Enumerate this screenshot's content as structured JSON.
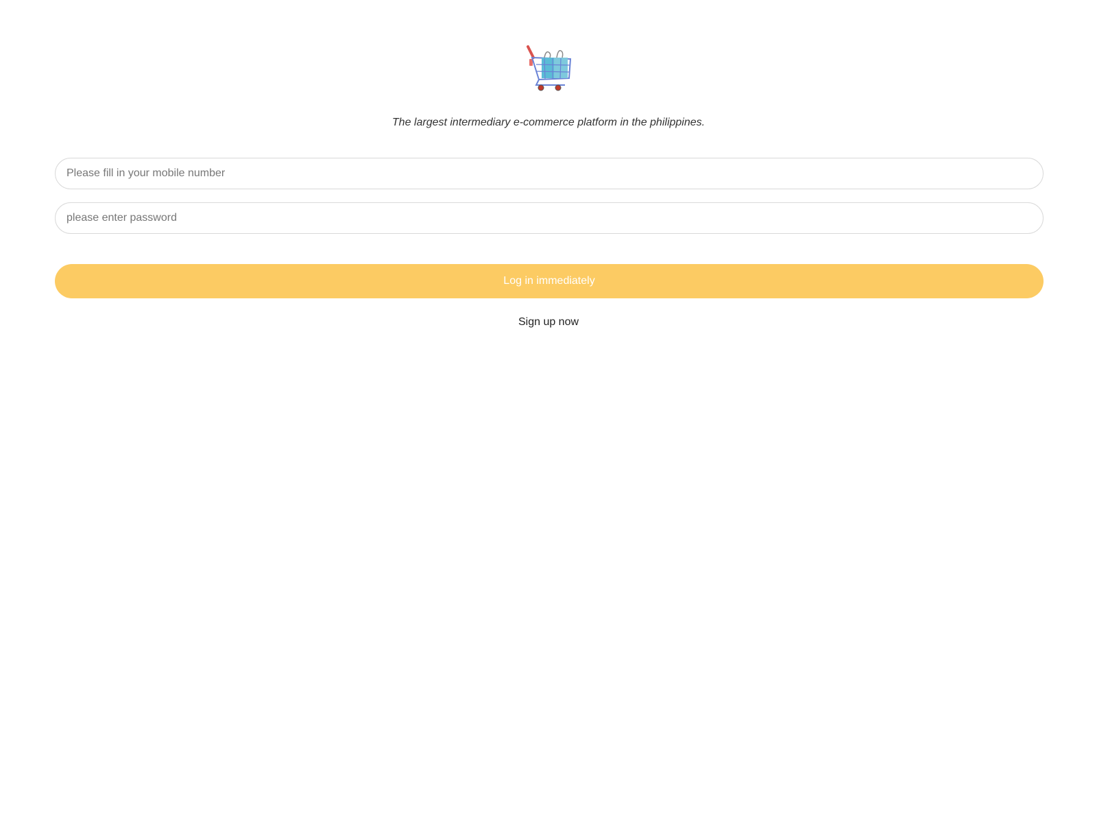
{
  "logo": {
    "icon": "shopping-cart-icon"
  },
  "tagline": "The largest intermediary e-commerce platform in the philippines.",
  "form": {
    "mobile": {
      "value": "",
      "placeholder": "Please fill in your mobile number"
    },
    "password": {
      "value": "",
      "placeholder": "please enter password"
    },
    "login_label": "Log in immediately",
    "signup_label": "Sign up now"
  },
  "colors": {
    "accent": "#fccb63",
    "field_border": "#d9d9d9",
    "text": "#333333"
  }
}
